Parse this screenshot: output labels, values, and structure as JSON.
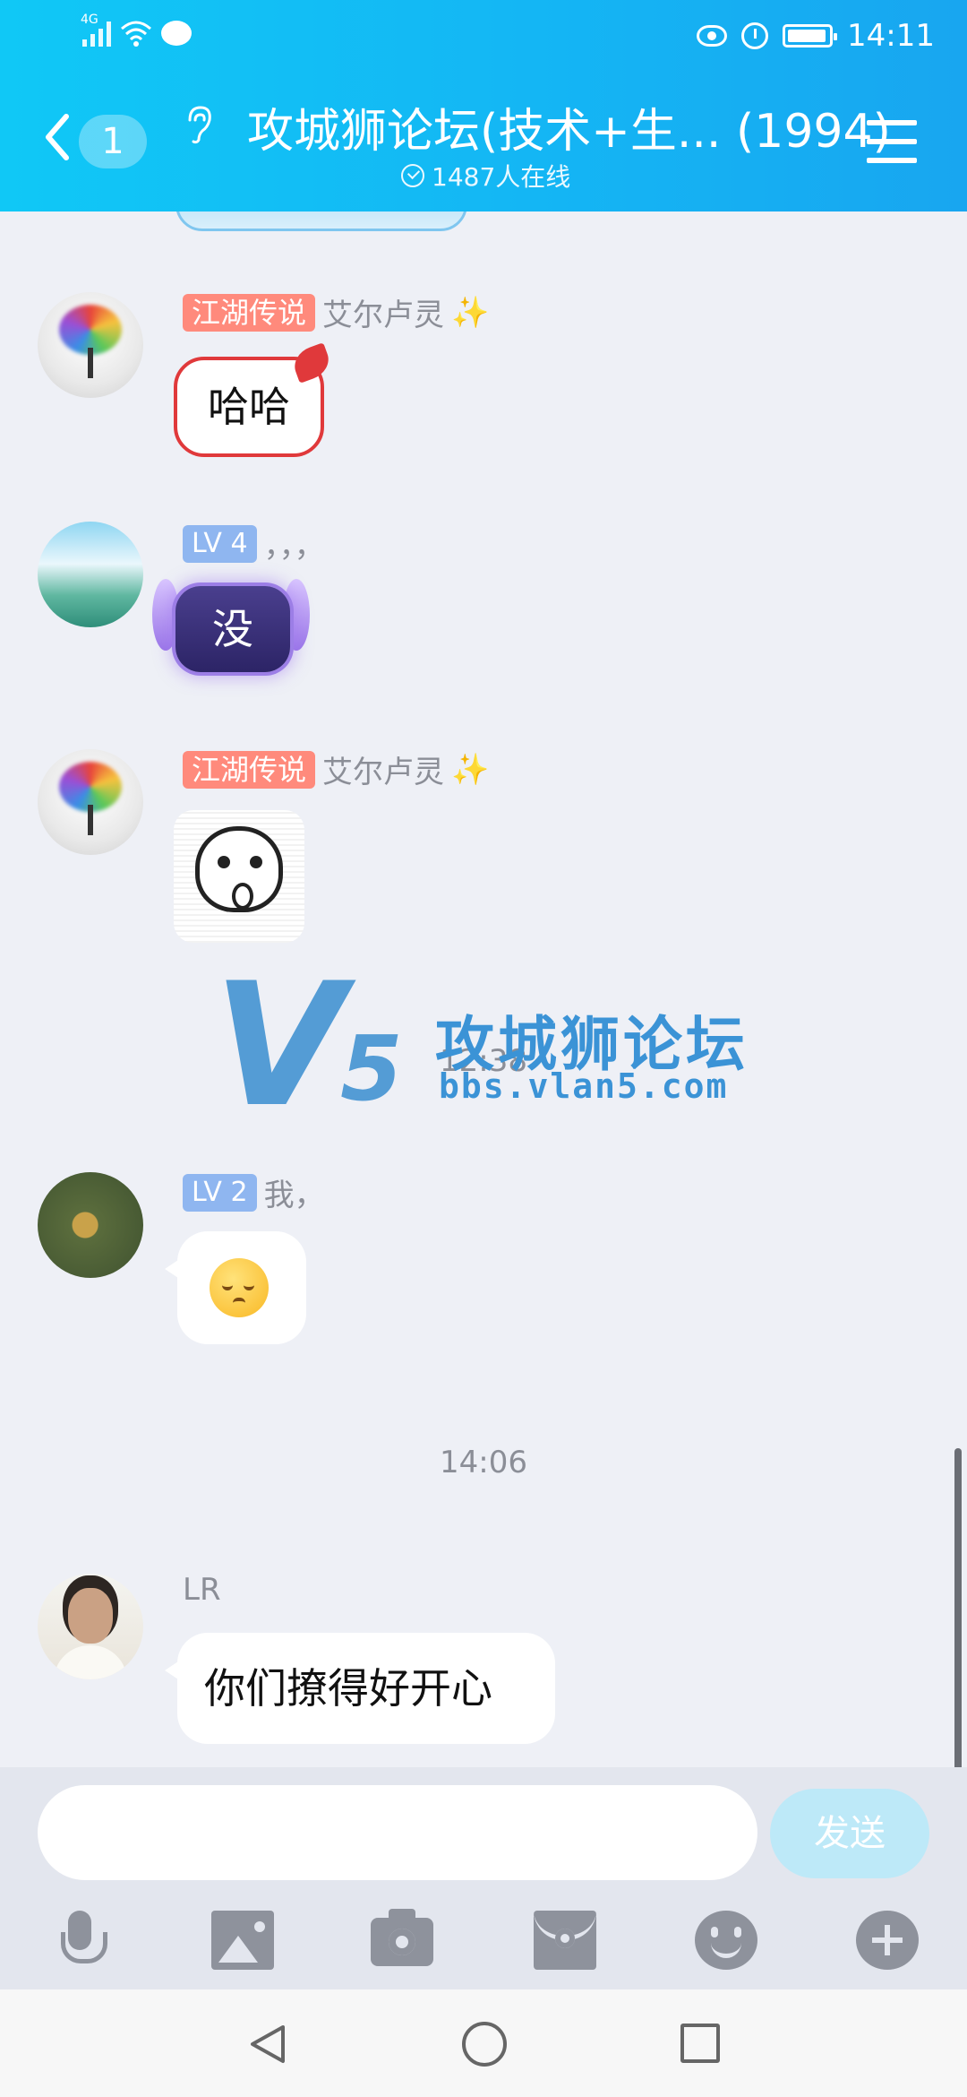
{
  "status_bar": {
    "network": "4G",
    "time": "14:11"
  },
  "header": {
    "unread_count": "1",
    "title": "攻城狮论坛(技术+生... (1994)",
    "online": "1487人在线"
  },
  "messages": [
    {
      "tag": "江湖传说",
      "name": "艾尔卢灵",
      "text": "哈哈"
    },
    {
      "tag": "LV 4",
      "name": "，，，",
      "text": "没"
    },
    {
      "tag": "江湖传说",
      "name": "艾尔卢灵",
      "sticker": "sticker"
    },
    {
      "tag": "LV 2",
      "name": "我，",
      "emoji": "smile-emoji"
    },
    {
      "name": "LR",
      "text": "你们撩得好开心"
    }
  ],
  "timestamps": [
    "12:38",
    "14:06"
  ],
  "watermark": {
    "logo": "V5",
    "name": "攻城狮论坛",
    "url": "bbs.vlan5.com"
  },
  "input": {
    "placeholder": "",
    "send_label": "发送"
  },
  "colors": {
    "header": "#14b6f4",
    "tag_red": "#ff8a7c",
    "tag_lv": "#8fb6f0",
    "send": "#bde9f8"
  }
}
